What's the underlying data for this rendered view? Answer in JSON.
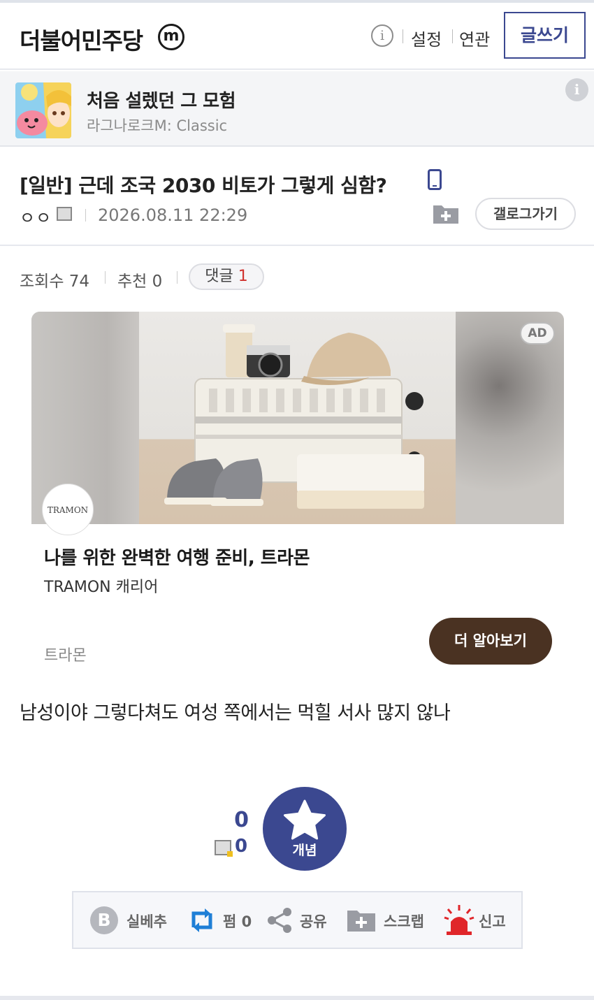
{
  "header": {
    "gallery_title": "더불어민주당",
    "m_badge": "m",
    "info_icon": "i",
    "settings": "설정",
    "related": "연관",
    "write": "글쓰기"
  },
  "game_banner": {
    "title": "처음 설렜던 그 모험",
    "subtitle": "라그나로크M: Classic",
    "info_icon": "i"
  },
  "post": {
    "title": "[일반] 근데 조국 2030 비토가 그렇게 심함?",
    "author": "ㅇㅇ",
    "date": "2026.08.11 22:29",
    "gallog_button": "갤로그가기",
    "views_label": "조회수 74",
    "recommend_label": "추천 0",
    "comment_label": "댓글",
    "comment_count": "1",
    "body": "남성이야 그렇다쳐도 여성 쪽에서는 먹힐 서사 많지 않나"
  },
  "ad": {
    "badge": "AD",
    "logo_text": "TRAMON",
    "headline": "나를 위한 완벽한 여행 준비, 트라몬",
    "description": "TRAMON 캐리어",
    "brand": "트라몬",
    "cta": "더 알아보기"
  },
  "recommend": {
    "up_count": "0",
    "fixed_count": "0",
    "button_label": "개념"
  },
  "actions": {
    "b_letter": "B",
    "realbest": "실베추",
    "retweet": "펌 0",
    "share": "공유",
    "scrap": "스크랩",
    "report": "신고"
  },
  "colors": {
    "accent": "#3b4890",
    "cta_brown": "#4a3222",
    "comment_red": "#d0312d",
    "report_red": "#e0262a"
  }
}
